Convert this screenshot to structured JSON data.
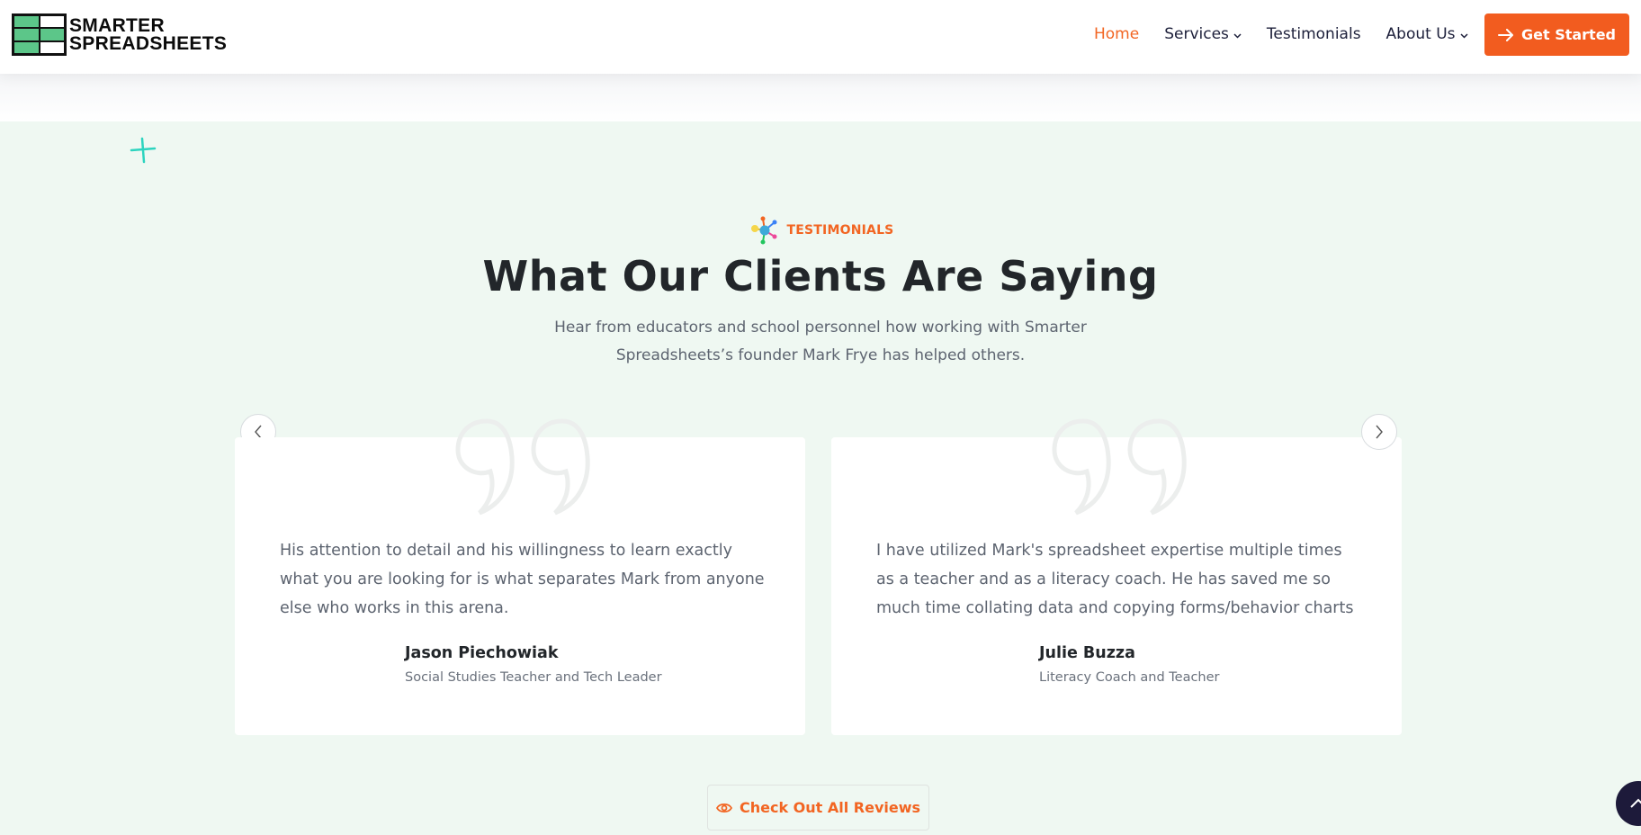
{
  "brand": {
    "line1": "SMARTER",
    "line2": "SPREADSHEETS"
  },
  "nav": {
    "items": [
      {
        "label": "Home",
        "active": true,
        "has_dropdown": false
      },
      {
        "label": "Services",
        "active": false,
        "has_dropdown": true
      },
      {
        "label": "Testimonials",
        "active": false,
        "has_dropdown": false
      },
      {
        "label": "About Us",
        "active": false,
        "has_dropdown": true
      }
    ],
    "cta_label": "Get Started"
  },
  "section": {
    "eyebrow": "TESTIMONIALS",
    "title": "What Our Clients Are Saying",
    "subtitle": "Hear from educators and school personnel how working with Smarter Spreadsheets’s founder Mark Frye has helped others."
  },
  "testimonials": [
    {
      "text": "His attention to detail and his willingness to learn exactly what you are looking for is what separates Mark from anyone else who works in this arena.",
      "name": "Jason Piechowiak",
      "role": "Social Studies Teacher and Tech Leader"
    },
    {
      "text": "I have utilized Mark's spreadsheet expertise multiple times as a teacher and as a literacy coach. He has saved me so much time collating data and copying forms/behavior charts",
      "name": "Julie Buzza",
      "role": "Literacy Coach and Teacher"
    }
  ],
  "reviews_button": "Check Out All Reviews",
  "colors": {
    "accent": "#f26522",
    "section_bg": "#eff8f2",
    "brand_green": "#5cc689",
    "dark": "#1d1a3a"
  },
  "icons": [
    "arrow-right-icon",
    "chevron-down-icon",
    "quote-icon",
    "eye-icon",
    "chevron-left-icon",
    "chevron-right-icon",
    "chevron-up-icon",
    "molecule-icon",
    "plus-icon"
  ]
}
